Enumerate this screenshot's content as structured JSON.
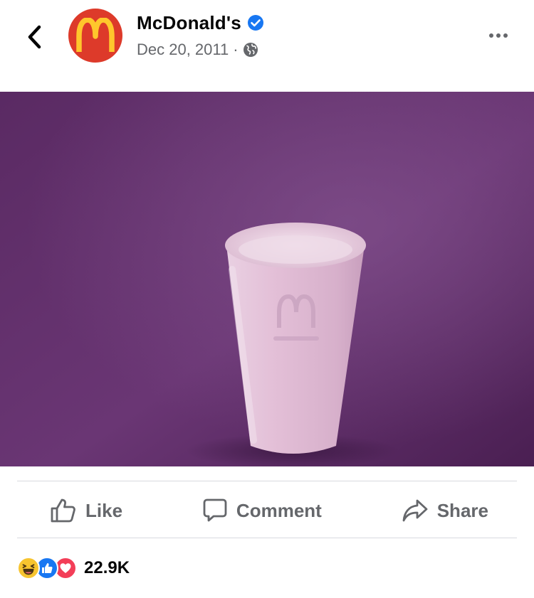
{
  "header": {
    "page_name": "McDonald's",
    "verified_icon": "verified-badge-icon",
    "date": "Dec 20, 2011",
    "separator": "·",
    "privacy_icon": "globe-icon",
    "back_icon": "chevron-left-icon",
    "more_icon": "more-horizontal-icon"
  },
  "colors": {
    "brand_red": "#dd3a2a",
    "arches_yellow": "#ffc72c",
    "verified_blue": "#1877f2",
    "secondary_text": "#65676b",
    "media_purple": "#66306e"
  },
  "actions": {
    "like_label": "Like",
    "comment_label": "Comment",
    "share_label": "Share"
  },
  "reactions": {
    "icons": [
      "haha-icon",
      "like-reaction-icon",
      "love-reaction-icon"
    ],
    "count": "22.9K"
  }
}
